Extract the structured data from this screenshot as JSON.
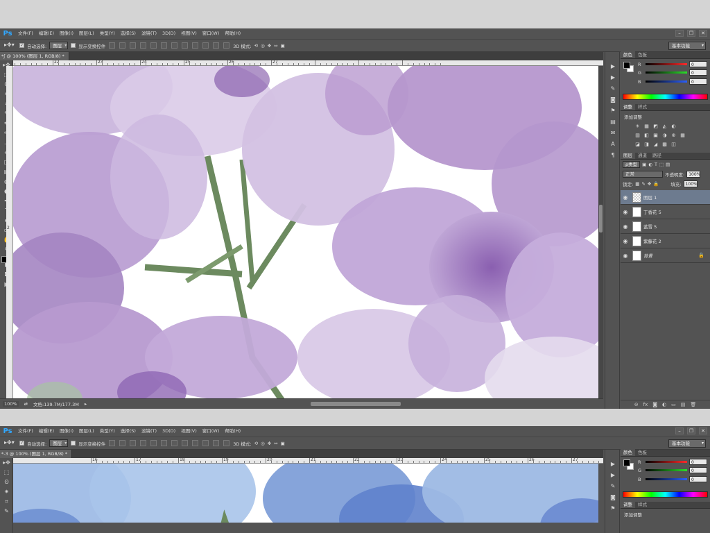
{
  "app": {
    "logo": "Ps",
    "menu": [
      "文件(F)",
      "编辑(E)",
      "图像(I)",
      "图层(L)",
      "类型(Y)",
      "选择(S)",
      "滤镜(T)",
      "3D(D)",
      "视图(V)",
      "窗口(W)",
      "帮助(H)"
    ],
    "window_controls": [
      "–",
      "❐",
      "✕"
    ],
    "workspace": "基本功能"
  },
  "options_bar": {
    "auto_select_label": "自动选择:",
    "auto_select_value": "图层",
    "show_transform_label": "显示变换控件",
    "mode_3d_label": "3D 模式:"
  },
  "tools": [
    "move-tool",
    "marquee-tool",
    "lasso-tool",
    "quick-select-tool",
    "crop-tool",
    "eyedropper-tool",
    "healing-tool",
    "brush-tool",
    "stamp-tool",
    "history-brush-tool",
    "eraser-tool",
    "gradient-tool",
    "blur-tool",
    "dodge-tool",
    "pen-tool",
    "type-tool",
    "path-select-tool",
    "shape-tool",
    "hand-tool",
    "zoom-tool"
  ],
  "tool_glyphs": [
    "▸✥",
    "⬚",
    "ʘ",
    "✷",
    "⌗",
    "✎",
    "✚",
    "✏",
    "⊥",
    "✐",
    "◫",
    "▤",
    "◍",
    "●",
    "✒",
    "T",
    "▸",
    "▭",
    "✋",
    "⚲"
  ],
  "strip_icons": [
    "▶",
    "▶",
    "✎",
    "◙",
    "⚑",
    "▤",
    "✉",
    "A",
    "¶"
  ],
  "doc1": {
    "tab": "*ʃ @ 100% (图层 1, RGB/8) *",
    "zoom": "100%",
    "doc_info": "文档:139.7M/177.3M",
    "ruler_top": [
      "",
      "22",
      "23",
      "24",
      "25",
      "26",
      "27",
      "",
      "",
      ""
    ],
    "ruler_left": [
      "",
      "",
      "",
      "",
      "",
      "2",
      "",
      "",
      "",
      "",
      ""
    ]
  },
  "doc2": {
    "tab": "*-3 @ 100% (图层 1, RGB/8) *",
    "ruler_top": [
      "16",
      "17",
      "18",
      "19",
      "20",
      "21",
      "22",
      "23",
      "24",
      "25",
      "26",
      "27"
    ]
  },
  "color_panel": {
    "tabs": [
      "颜色",
      "色板"
    ],
    "channels": [
      {
        "name": "R",
        "value": "0",
        "color": "#ff2a2a"
      },
      {
        "name": "G",
        "value": "0",
        "color": "#2adf2a"
      },
      {
        "name": "B",
        "value": "0",
        "color": "#2a5fff"
      }
    ]
  },
  "adjust_panel": {
    "tabs": [
      "调整",
      "样式"
    ],
    "add_label": "添加调整",
    "row1": [
      "☀",
      "▦",
      "◩",
      "◭",
      "◐"
    ],
    "row2": [
      "▥",
      "◧",
      "▣",
      "◑",
      "⊕",
      "▦"
    ],
    "row3": [
      "◪",
      "◨",
      "◢",
      "▩",
      "◫"
    ]
  },
  "layers_panel": {
    "tabs": [
      "图层",
      "通道",
      "路径"
    ],
    "filter": "ρ类型",
    "blend_mode": "正常",
    "opacity_label": "不透明度:",
    "opacity_value": "100%",
    "lock_label": "锁定:",
    "fill_label": "填充:",
    "fill_value": "100%",
    "layers": [
      {
        "name": "图层 1",
        "selected": true,
        "thumb": "trans"
      },
      {
        "name": "丁香花 5",
        "selected": false,
        "thumb": "smart"
      },
      {
        "name": "蓝雪 5",
        "selected": false,
        "thumb": "smart"
      },
      {
        "name": "紫藤花 2",
        "selected": false,
        "thumb": "smart"
      },
      {
        "name": "背景",
        "selected": false,
        "thumb": "white",
        "locked": true
      }
    ],
    "bottom_icons": [
      "⊖",
      "fx",
      "◙",
      "◐",
      "▭",
      "▤",
      "🗑"
    ]
  },
  "colors": {
    "ui_bg": "#535353",
    "selected_layer": "#6d7b8f",
    "ps_blue": "#31a8ff",
    "petal_purple": "#a98bc4",
    "petal_blue": "#7f9fd8",
    "stem_green": "#6c8a5f"
  }
}
